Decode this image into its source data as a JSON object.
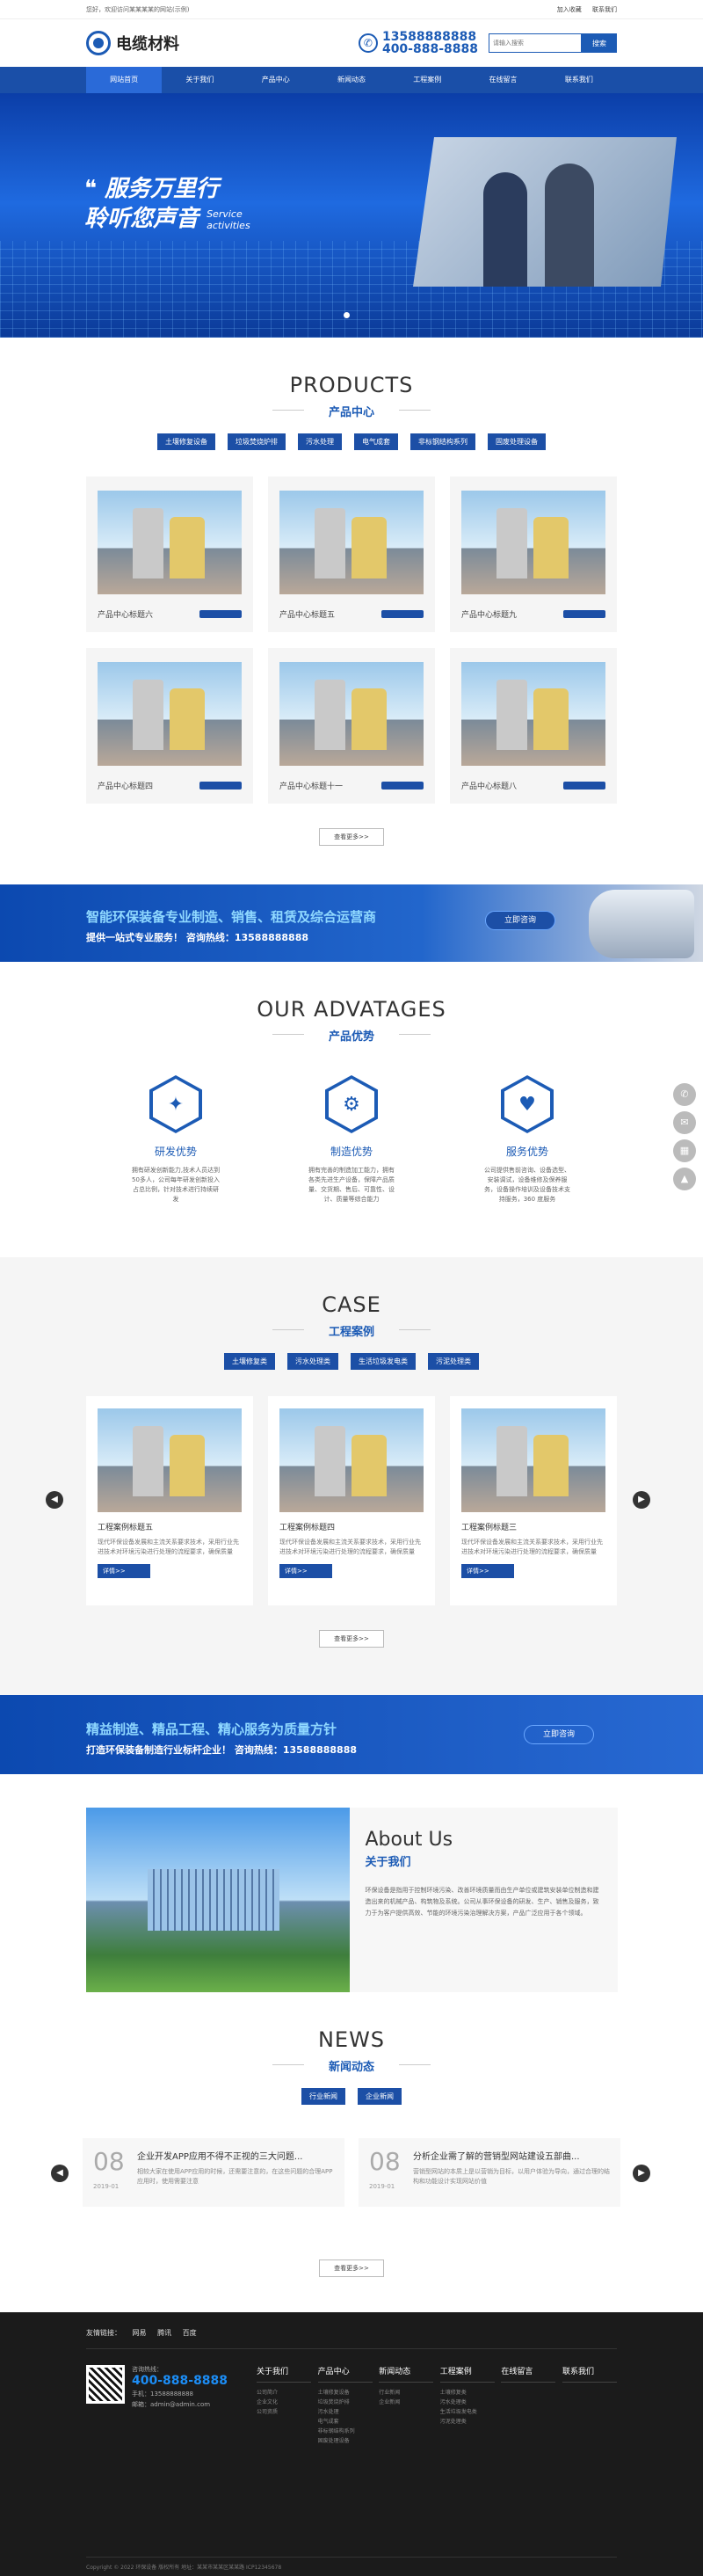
{
  "topbar": {
    "left": "您好，欢迎访问某某某某的网站(示例)",
    "links": [
      "加入收藏",
      "联系我们"
    ]
  },
  "header": {
    "logo": "电缆材料",
    "phone1": "13588888888",
    "phone2": "400-888-8888",
    "search_placeholder": "请输入搜索",
    "search_btn": "搜索"
  },
  "nav": [
    "网站首页",
    "关于我们",
    "产品中心",
    "新闻动态",
    "工程案例",
    "在线留言",
    "联系我们"
  ],
  "hero": {
    "line1": "服务万里行",
    "line2": "聆听您声音",
    "en1": "Service",
    "en2": "activities"
  },
  "products": {
    "en": "PRODUCTS",
    "cn": "产品中心",
    "cats": [
      "土壤修复设备",
      "垃圾焚烧炉排",
      "污水处理",
      "电气成套",
      "非标钢结构系列",
      "固废处理设备"
    ],
    "items": [
      "产品中心标题六",
      "产品中心标题五",
      "产品中心标题九",
      "产品中心标题四",
      "产品中心标题十一",
      "产品中心标题八"
    ],
    "more": "查看更多>>"
  },
  "banner1": {
    "line1": "智能环保装备专业制造、销售、租赁及综合运营商",
    "line2": "提供一站式专业服务！ 咨询热线：13588888888",
    "btn": "立即咨询"
  },
  "advantages": {
    "en": "OUR ADVATAGES",
    "cn": "产品优势",
    "items": [
      {
        "name": "研发优势",
        "icon": "lightbulb-icon",
        "desc": "拥有研发创新能力,技术人员达到50多人，公司每年研发创新投入占总比例，针对技术进行持续研发"
      },
      {
        "name": "制造优势",
        "icon": "gear-icon",
        "desc": "拥有完善的制造加工能力，拥有各类先进生产设备，保障产品质量、交货期、售后、可靠性、设计、质量等综合能力"
      },
      {
        "name": "服务优势",
        "icon": "heart-icon",
        "desc": "公司提供售前咨询、设备选型、安装调试，设备维修及保养服务，设备操作培训及设备技术支持服务，360 度服务"
      }
    ]
  },
  "case": {
    "en": "CASE",
    "cn": "工程案例",
    "cats": [
      "土壤修复类",
      "污水处理类",
      "生活垃圾发电类",
      "污泥处理类"
    ],
    "items": [
      {
        "title": "工程案例标题五",
        "desc": "现代环保设备发展和主流关系要求技术，采用行业先进技术对环境污染进行处理的流程要求，确保质量"
      },
      {
        "title": "工程案例标题四",
        "desc": "现代环保设备发展和主流关系要求技术，采用行业先进技术对环境污染进行处理的流程要求，确保质量"
      },
      {
        "title": "工程案例标题三",
        "desc": "现代环保设备发展和主流关系要求技术，采用行业先进技术对环境污染进行处理的流程要求，确保质量"
      }
    ],
    "detail": "详情>>",
    "more": "查看更多>>"
  },
  "banner2": {
    "line1": "精益制造、精品工程、精心服务为质量方针",
    "line2": "打造环保装备制造行业标杆企业！ 咨询热线：13588888888",
    "btn": "立即咨询"
  },
  "about": {
    "en": "About Us",
    "cn": "关于我们",
    "desc": "环保设备是指用于控制环境污染、改善环境质量而由生产单位或建筑安装单位制造和建造出来的机械产品、构筑物及系统。公司从事环保设备的研发、生产、销售及服务，致力于为客户提供高效、节能的环境污染治理解决方案，产品广泛应用于各个领域。"
  },
  "news": {
    "en": "NEWS",
    "cn": "新闻动态",
    "cats": [
      "行业新闻",
      "企业新闻"
    ],
    "items": [
      {
        "day": "08",
        "ym": "2019-01",
        "title": "企业开发APP应用不得不正视的三大问题...",
        "desc": "相较大家在使用APP应用的时候，还需要注意的，在这些问题的合理APP应用时，使用需要注意"
      },
      {
        "day": "08",
        "ym": "2019-01",
        "title": "分析企业需了解的营销型网站建设五部曲...",
        "desc": "营销型网站的本质上是以营销为目标，以用户体验为导向，通过合理的结构和功能设计实现网站价值"
      }
    ],
    "more": "查看更多>>"
  },
  "footer": {
    "links_label": "友情链接：",
    "links": [
      "网易",
      "腾讯",
      "百度"
    ],
    "hotline_label": "咨询热线：",
    "hotline": "400-888-8888",
    "mobile": "手机：13588888888",
    "email": "邮箱：admin@admin.com",
    "cols": [
      {
        "h": "关于我们",
        "i": [
          "公司简介",
          "企业文化",
          "公司资质"
        ]
      },
      {
        "h": "产品中心",
        "i": [
          "土壤修复设备",
          "垃圾焚烧炉排",
          "污水处理",
          "电气成套",
          "非标钢结构系列",
          "固废处理设备"
        ]
      },
      {
        "h": "新闻动态",
        "i": [
          "行业新闻",
          "企业新闻"
        ]
      },
      {
        "h": "工程案例",
        "i": [
          "土壤修复类",
          "污水处理类",
          "生活垃圾发电类",
          "污泥处理类"
        ]
      },
      {
        "h": "在线留言",
        "i": []
      },
      {
        "h": "联系我们",
        "i": []
      }
    ],
    "copyright": "Copyright © 2022 环保设备 版权所有  地址：某某市某某区某某路  ICP12345678"
  }
}
